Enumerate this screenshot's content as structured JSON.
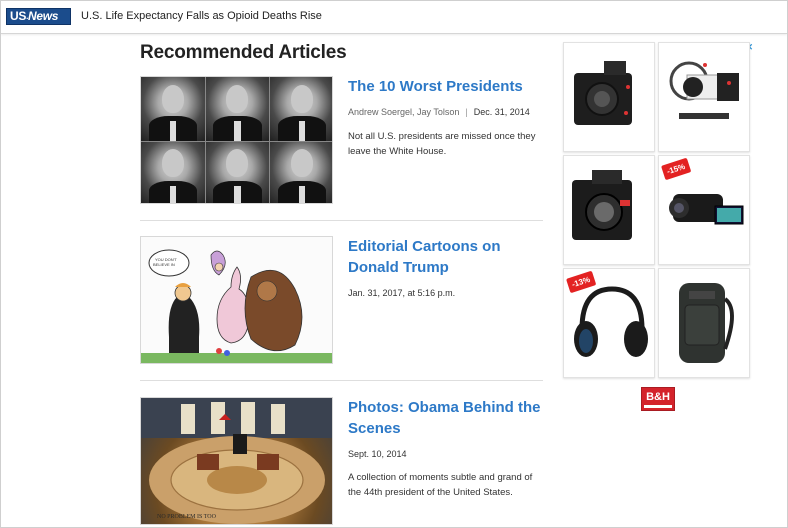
{
  "header": {
    "logo_us": "US",
    "logo_news": "News",
    "headline": "U.S. Life Expectancy Falls as Opioid Deaths Rise"
  },
  "main": {
    "section_title": "Recommended Articles",
    "articles": [
      {
        "title": "The 10 Worst Presidents",
        "authors": "Andrew Soergel, Jay Tolson",
        "date": "Dec. 31, 2014",
        "description": "Not all U.S. presidents are missed once they leave the White House."
      },
      {
        "title": "Editorial Cartoons on Donald Trump",
        "date": "Jan. 31, 2017, at 5:16 p.m.",
        "description": ""
      },
      {
        "title": "Photos: Obama Behind the Scenes",
        "date": "Sept. 10, 2014",
        "description": "A collection of moments subtle and grand of the 44th president of the United States."
      }
    ]
  },
  "ads": {
    "adchoices_label": "▷✕",
    "badges": [
      "-15%",
      "-13%"
    ],
    "advertiser_logo": "B&H"
  },
  "colors": {
    "link_blue": "#2d79c7",
    "brand_navy": "#1b4c8c",
    "sale_red": "#e32222"
  }
}
